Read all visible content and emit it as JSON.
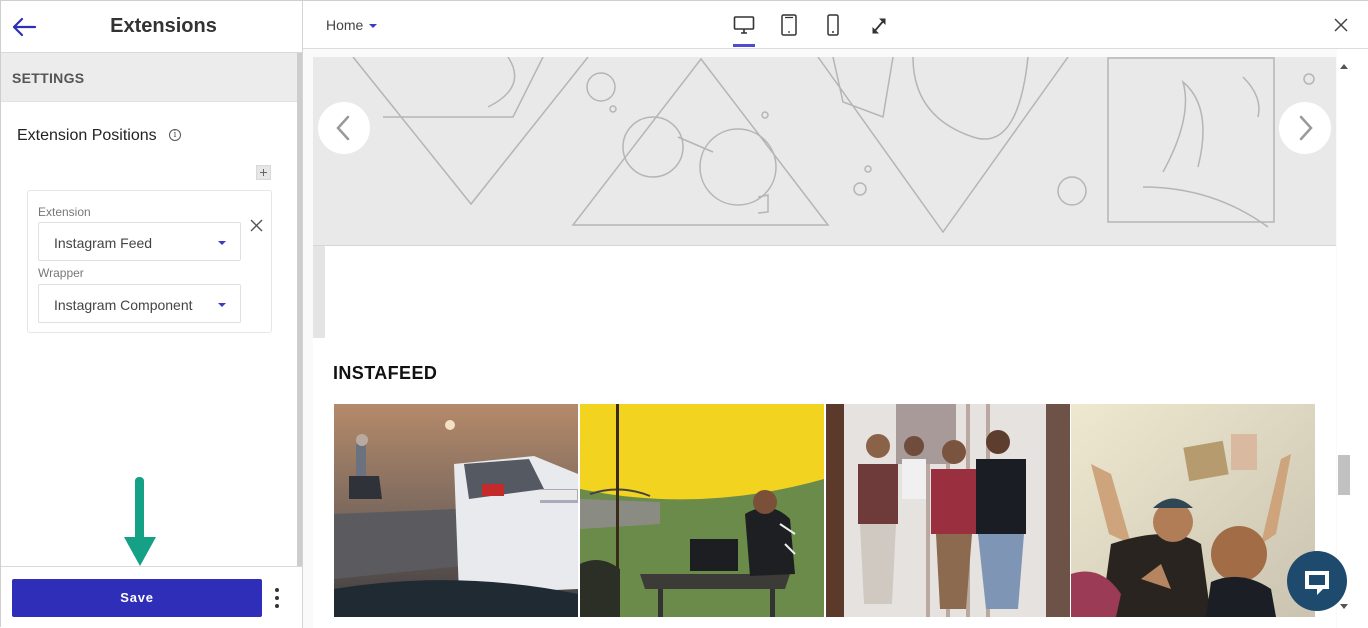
{
  "panel": {
    "title": "Extensions",
    "section": "SETTINGS",
    "positions_title": "Extension Positions",
    "info_glyph": "i",
    "extension_label": "Extension",
    "extension_value": "Instagram Feed",
    "wrapper_label": "Wrapper",
    "wrapper_value": "Instagram Component",
    "save_label": "Save"
  },
  "topbar": {
    "page": "Home",
    "devices": [
      "desktop-icon",
      "tablet-icon",
      "mobile-icon",
      "fullscreen-icon"
    ],
    "active_device": "desktop"
  },
  "preview": {
    "instafeed_title": "INSTAFEED",
    "photos": [
      "rainy-road-photo",
      "yellow-tent-photo",
      "group-of-friends-photo",
      "selfie-photo"
    ]
  },
  "colors": {
    "accent": "#2e2eb8",
    "arrow": "#14a185",
    "chat": "#1e4a6e"
  }
}
